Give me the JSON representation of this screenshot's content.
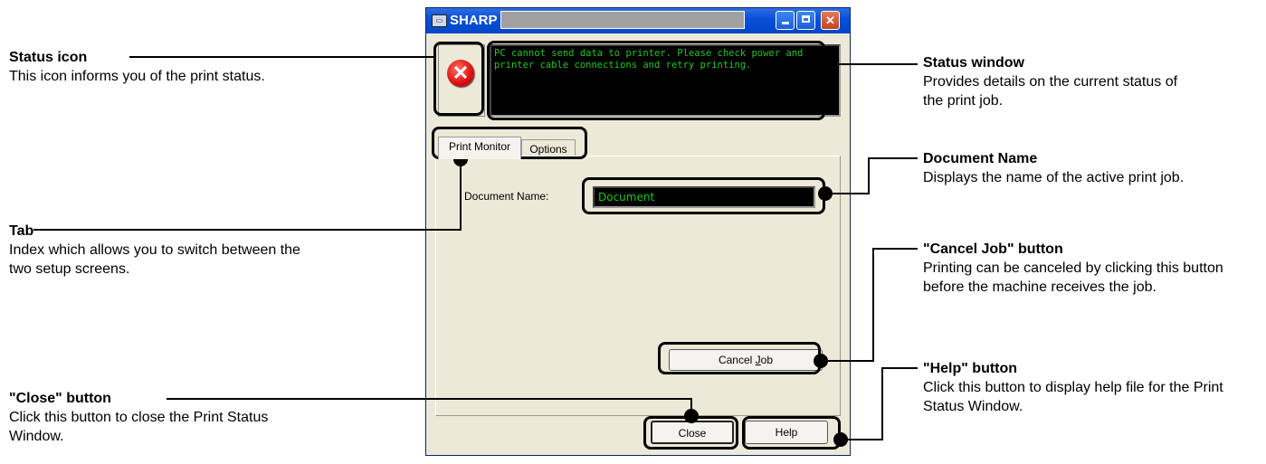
{
  "window": {
    "title": "SHARP",
    "app_icon": "printer-icon",
    "status_icon": "error-icon",
    "status_icon_glyph": "✕",
    "status_message": "PC cannot send data to printer. Please check power and printer cable connections and retry printing.",
    "tabs": [
      "Print Monitor",
      "Options"
    ],
    "document_name_label": "Document Name:",
    "document_name_value": "Document",
    "cancel_job_pre": "Cancel ",
    "cancel_job_mnemonic": "J",
    "cancel_job_post": "ob",
    "close_label": "Close",
    "help_label": "Help",
    "status_text_color": "#1ec81e"
  },
  "annotations": {
    "status_icon": {
      "heading": "Status icon",
      "text": "This icon informs you of the print status."
    },
    "tab": {
      "heading": "Tab",
      "text": "Index which allows you to switch between the two setup screens."
    },
    "close_button": {
      "heading": "\"Close\" button",
      "text": "Click this button to close the Print Status Window."
    },
    "status_window": {
      "heading": "Status window",
      "text": "Provides details on the current status of the print job."
    },
    "document_name": {
      "heading": "Document Name",
      "text": "Displays the name of the active print job."
    },
    "cancel_job_button": {
      "heading": "\"Cancel Job\" button",
      "text": "Printing can be canceled by clicking this button before the machine receives the job."
    },
    "help_button": {
      "heading": "\"Help\" button",
      "text": "Click this button to display help file for the Print Status Window."
    }
  }
}
